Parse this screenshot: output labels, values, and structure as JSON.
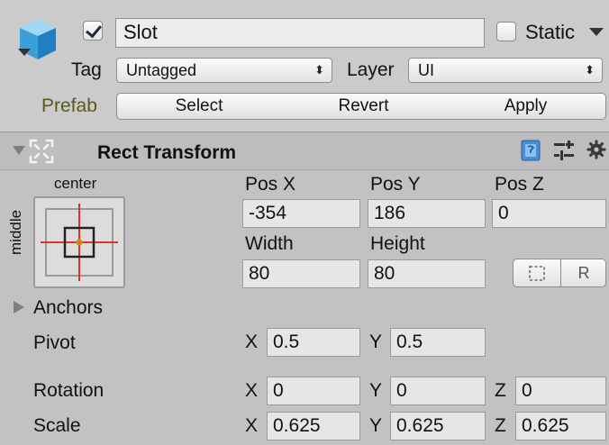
{
  "gameobject": {
    "active": true,
    "name": "Slot",
    "static_label": "Static",
    "static_checked": false,
    "tag_label": "Tag",
    "tag_value": "Untagged",
    "layer_label": "Layer",
    "layer_value": "UI",
    "prefab_label": "Prefab",
    "prefab_buttons": [
      "Select",
      "Revert",
      "Apply"
    ],
    "accent_prefab_color": "#5b5a1a"
  },
  "rect_transform": {
    "title": "Rect Transform",
    "anchor_preset": {
      "horizontal": "center",
      "vertical": "middle"
    },
    "pos": {
      "x_label": "Pos X",
      "y_label": "Pos Y",
      "z_label": "Pos Z",
      "x": "-354",
      "y": "186",
      "z": "0"
    },
    "size": {
      "width_label": "Width",
      "height_label": "Height",
      "width": "80",
      "height": "80"
    },
    "raw_edit_letter": "R",
    "anchors_label": "Anchors",
    "pivot": {
      "label": "Pivot",
      "x_axis": "X",
      "y_axis": "Y",
      "x": "0.5",
      "y": "0.5"
    },
    "rotation": {
      "label": "Rotation",
      "x_axis": "X",
      "y_axis": "Y",
      "z_axis": "Z",
      "x": "0",
      "y": "0",
      "z": "0"
    },
    "scale": {
      "label": "Scale",
      "x_axis": "X",
      "y_axis": "Y",
      "z_axis": "Z",
      "x": "0.625",
      "y": "0.625",
      "z": "0.625"
    }
  },
  "icons": [
    "cube-icon",
    "dropdown-arrow-icon",
    "rect-transform-icon",
    "book-icon",
    "presets-icon",
    "gear-icon",
    "foldout-arrow-icon",
    "blueprint-mode-icon"
  ]
}
